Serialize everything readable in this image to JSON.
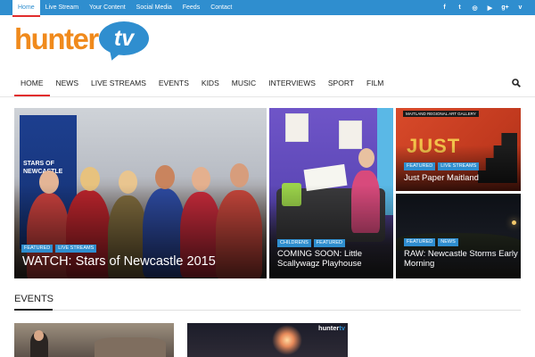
{
  "top_nav": [
    "Home",
    "Live Stream",
    "Your Content",
    "Social Media",
    "Feeds",
    "Contact"
  ],
  "social_icons": [
    "facebook-icon",
    "twitter-icon",
    "instagram-icon",
    "youtube-icon",
    "googleplus-icon",
    "vimeo-icon"
  ],
  "social_glyphs": [
    "f",
    "t",
    "◎",
    "▶",
    "g+",
    "v"
  ],
  "logo": {
    "text": "hunter",
    "badge": "tv"
  },
  "main_nav": [
    "HOME",
    "NEWS",
    "LIVE STREAMS",
    "EVENTS",
    "KIDS",
    "MUSIC",
    "INTERVIEWS",
    "SPORT",
    "FILM"
  ],
  "tiles": [
    {
      "tags": [
        "FEATURED",
        "LIVE STREAMS"
      ],
      "title": "WATCH: Stars of Newcastle 2015",
      "image_text": "STARS OF NEWCASTLE"
    },
    {
      "tags": [
        "CHILDRENS",
        "FEATURED"
      ],
      "title": "COMING SOON: Little Scallywagz Playhouse"
    },
    {
      "tags": [
        "FEATURED",
        "LIVE STREAMS"
      ],
      "title": "Just Paper Maitland",
      "image_text_top": "MAITLAND REGIONAL ART GALLERY",
      "image_text_big": "JUST"
    },
    {
      "tags": [
        "FEATURED",
        "NEWS"
      ],
      "title": "RAW: Newcastle Storms Early Morning"
    }
  ],
  "events": {
    "heading": "EVENTS",
    "card2_logo": {
      "a": "hunter",
      "b": "tv"
    }
  },
  "colors": {
    "brand_blue": "#2f8ecf",
    "brand_orange": "#f08a1c",
    "accent_red": "#e12d2d"
  }
}
